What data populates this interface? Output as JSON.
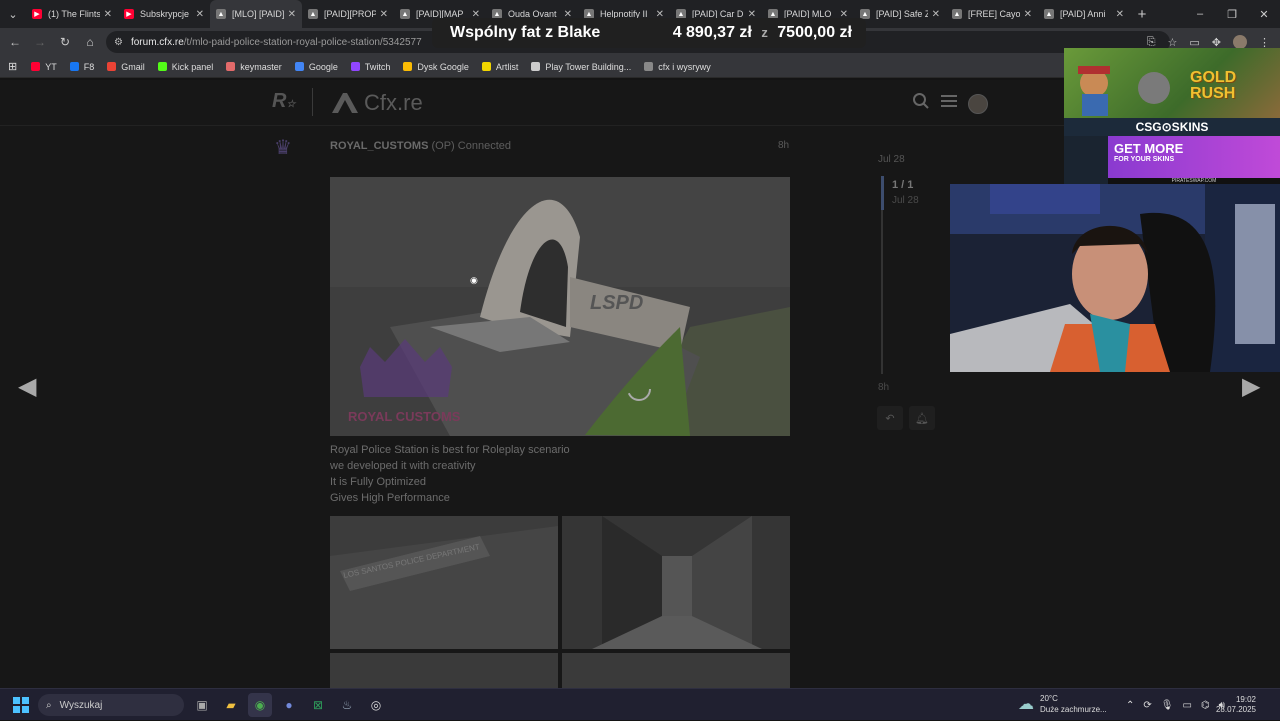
{
  "browser": {
    "tabs": [
      {
        "label": "(1) The Flints",
        "icon": "youtube-icon",
        "color": "#ff0033"
      },
      {
        "label": "Subskrypcje",
        "icon": "youtube-icon",
        "color": "#ff0033"
      },
      {
        "label": "[MLO] [PAID]",
        "icon": "cfx-icon",
        "color": "#777777",
        "active": true
      },
      {
        "label": "[PAID][PROP",
        "icon": "cfx-icon",
        "color": "#777777"
      },
      {
        "label": "[PAID][MAP",
        "icon": "cfx-icon",
        "color": "#777777"
      },
      {
        "label": "Ouda Ovant",
        "icon": "cfx-icon",
        "color": "#777777"
      },
      {
        "label": "Helpnotify II",
        "icon": "cfx-icon",
        "color": "#777777"
      },
      {
        "label": "[PAID] Car D",
        "icon": "cfx-icon",
        "color": "#777777"
      },
      {
        "label": "[PAID] MLO",
        "icon": "cfx-icon",
        "color": "#777777"
      },
      {
        "label": "[PAID] Safe Z",
        "icon": "cfx-icon",
        "color": "#777777"
      },
      {
        "label": "[FREE] Cayo",
        "icon": "cfx-icon",
        "color": "#777777"
      },
      {
        "label": "[PAID] Anni",
        "icon": "cfx-icon",
        "color": "#777777"
      }
    ],
    "url_host": "forum.cfx.re",
    "url_path": "/t/mlo-paid-police-station-royal-police-station/5342577",
    "bookmarks": [
      {
        "label": "YT",
        "icon": "youtube-icon",
        "color": "#ff0033"
      },
      {
        "label": "F8",
        "icon": "facebook-icon",
        "color": "#1877f2"
      },
      {
        "label": "Gmail",
        "icon": "gmail-icon",
        "color": "#ea4335"
      },
      {
        "label": "Kick panel",
        "icon": "kick-icon",
        "color": "#53fc18"
      },
      {
        "label": "keymaster",
        "icon": "keymaster-icon",
        "color": "#e26a6a"
      },
      {
        "label": "Google",
        "icon": "google-icon",
        "color": "#4285f4"
      },
      {
        "label": "Twitch",
        "icon": "twitch-icon",
        "color": "#9146ff"
      },
      {
        "label": "Dysk Google",
        "icon": "drive-icon",
        "color": "#fbbc04"
      },
      {
        "label": "Artlist",
        "icon": "artlist-icon",
        "color": "#f2d600"
      },
      {
        "label": "Play Tower Building...",
        "icon": "game-icon",
        "color": "#cccccc"
      },
      {
        "label": "cfx i wysrywy",
        "icon": "cfx-icon",
        "color": "#888888"
      }
    ]
  },
  "forum": {
    "site_name": "Cfx.re",
    "post_user": "ROYAL_CUSTOMS",
    "post_op": "(OP)",
    "post_status": "Connected",
    "post_time": "8h",
    "image_label": "LSPD",
    "watermark": "ROYAL CUSTOMS",
    "body_lines": [
      "Royal Police Station is best for Roleplay scenario",
      "we developed it with creativity",
      "It is Fully Optimized",
      "Gives High Performance"
    ],
    "thumb_sign": "LOS SANTOS POLICE DEPARTMENT",
    "timeline_top": "Jul 28",
    "timeline_count": "1 / 1",
    "timeline_date": "Jul 28",
    "timeline_end": "8h"
  },
  "overlay": {
    "donation_title": "Wspólny fat z Blake",
    "donation_current": "4 890,37 zł",
    "donation_sep": "z",
    "donation_goal": "7500,00 zł",
    "ad_gold": "GOLD RUSH",
    "ad_brand": "CSG⊙SKINS",
    "ad_getmore": "GET MORE",
    "ad_getmore_sub": "FOR YOUR SKINS",
    "ad_footer": "PIRATESWAP.COM"
  },
  "taskbar": {
    "search_placeholder": "Wyszukaj",
    "temperature": "20°C",
    "weather_desc": "Duże zachmurze...",
    "time": "19:02",
    "date": "28.07.2025"
  }
}
